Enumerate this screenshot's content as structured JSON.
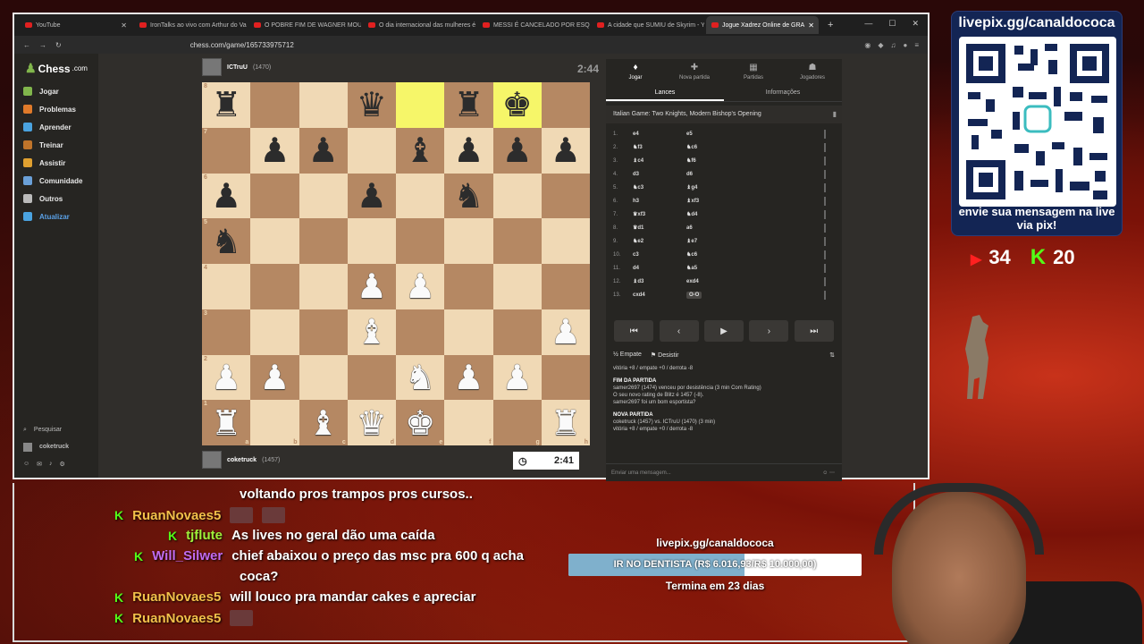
{
  "browser": {
    "tabs": [
      {
        "label": "YouTube",
        "active": false
      },
      {
        "label": "IronTalks ao vivo com Arthur do Val",
        "active": false
      },
      {
        "label": "O POBRE FIM DE WAGNER MOURA",
        "active": false
      },
      {
        "label": "O dia internacional das mulheres é u",
        "active": false
      },
      {
        "label": "MESSI É CANCELADO POR ESQUERD",
        "active": false
      },
      {
        "label": "A cidade que SUMIU de Skyrim - You",
        "active": false
      },
      {
        "label": "Jogue Xadrez Online de GRA",
        "active": true
      }
    ],
    "url": "chess.com/game/165733975712"
  },
  "sidebar": {
    "logo": "Chess",
    "logo_suffix": ".com",
    "items": [
      {
        "label": "Jogar",
        "color": "#81b64c"
      },
      {
        "label": "Problemas",
        "color": "#e07a2a"
      },
      {
        "label": "Aprender",
        "color": "#4aa3e0"
      },
      {
        "label": "Treinar",
        "color": "#c0742a"
      },
      {
        "label": "Assistir",
        "color": "#e0a030"
      },
      {
        "label": "Comunidade",
        "color": "#6aa0d8"
      },
      {
        "label": "Outros",
        "color": "#bbbbbb"
      },
      {
        "label": "Atualizar",
        "color": "#4aa3e0"
      }
    ],
    "search": "Pesquisar",
    "user": "coketruck"
  },
  "game": {
    "top_player": {
      "name": "ICTruU",
      "rating": "(1470)",
      "clock": "2:44"
    },
    "bottom_player": {
      "name": "coketruck",
      "rating": "(1457)",
      "clock": "2:41"
    },
    "board": [
      [
        "br",
        "",
        "",
        "bq",
        "",
        "br",
        "bk",
        ""
      ],
      [
        "",
        "bp",
        "bp",
        "",
        "bb",
        "bp",
        "bp",
        "bp"
      ],
      [
        "bp",
        "",
        "",
        "bp",
        "",
        "bn",
        "",
        ""
      ],
      [
        "bn",
        "",
        "",
        "",
        "",
        "",
        "",
        ""
      ],
      [
        "",
        "",
        "",
        "wp",
        "wp",
        "",
        "",
        ""
      ],
      [
        "",
        "",
        "",
        "wb",
        "",
        "",
        "",
        "wp"
      ],
      [
        "wp",
        "wp",
        "",
        "",
        "wn",
        "wp",
        "wp",
        ""
      ],
      [
        "wr",
        "",
        "wb",
        "wq",
        "wk",
        "",
        "",
        "wr"
      ]
    ],
    "highlight": [
      "e8",
      "g8"
    ],
    "ranks": [
      "8",
      "7",
      "6",
      "5",
      "4",
      "3",
      "2",
      "1"
    ],
    "files": [
      "a",
      "b",
      "c",
      "d",
      "e",
      "f",
      "g",
      "h"
    ]
  },
  "panel": {
    "tabs": [
      {
        "label": "Jogar",
        "icon": "♦"
      },
      {
        "label": "Nova partida",
        "icon": "✚"
      },
      {
        "label": "Partidas",
        "icon": "▦"
      },
      {
        "label": "Jogadores",
        "icon": "☗"
      }
    ],
    "subtabs": [
      "Lances",
      "Informações"
    ],
    "opening": "Italian Game: Two Knights, Modern Bishop's Opening",
    "moves": [
      {
        "n": "1.",
        "w": "e4",
        "b": "e5"
      },
      {
        "n": "2.",
        "w": "♞f3",
        "b": "♞c6"
      },
      {
        "n": "3.",
        "w": "♝c4",
        "b": "♞f6"
      },
      {
        "n": "4.",
        "w": "d3",
        "b": "d6"
      },
      {
        "n": "5.",
        "w": "♞c3",
        "b": "♝g4"
      },
      {
        "n": "6.",
        "w": "h3",
        "b": "♝xf3"
      },
      {
        "n": "7.",
        "w": "♛xf3",
        "b": "♞d4"
      },
      {
        "n": "8.",
        "w": "♛d1",
        "b": "a6"
      },
      {
        "n": "9.",
        "w": "♞e2",
        "b": "♝e7"
      },
      {
        "n": "10.",
        "w": "c3",
        "b": "♞c6"
      },
      {
        "n": "11.",
        "w": "d4",
        "b": "♞a5"
      },
      {
        "n": "12.",
        "w": "♝d3",
        "b": "exd4"
      },
      {
        "n": "13.",
        "w": "cxd4",
        "b": "O-O"
      }
    ],
    "controls": [
      "⏮",
      "‹",
      "▶",
      "›",
      "⏭"
    ],
    "actions": {
      "draw": "Empate",
      "resign": "Desistir"
    },
    "log": [
      {
        "bold": false,
        "text": "vitória +8 / empate +0 / derrota -8"
      },
      {
        "bold": true,
        "text": "FIM DA PARTIDA"
      },
      {
        "bold": false,
        "text": "samer2697 (1474) venceu por desistência (3 min Com Rating)"
      },
      {
        "bold": false,
        "text": "O seu novo rating de Blitz é 1457 (-8)."
      },
      {
        "bold": false,
        "text": "samer2697 foi um bom esportista?"
      },
      {
        "bold": true,
        "text": "NOVA PARTIDA"
      },
      {
        "bold": false,
        "text": "coketruck (1457) vs. ICTruU (1470) (3 min)"
      },
      {
        "bold": false,
        "text": "vitória +8 / empate +0 / derrota -8"
      }
    ],
    "message_placeholder": "Enviar uma mensagem..."
  },
  "overlay": {
    "qr_header": "livepix.gg/canaldococa",
    "qr_footer": "envie sua mensagem na live via pix!",
    "youtube_count": "34",
    "kick_count": "20",
    "chat": [
      {
        "user": "",
        "text": "voltando pros trampos pros cursos..",
        "user_color": "#ffffff"
      },
      {
        "user": "RuanNovaes5",
        "text": "",
        "user_color": "#f2c04a"
      },
      {
        "user": "tjflute",
        "text": "As lives no geral dão uma caída",
        "user_color": "#9ef03a"
      },
      {
        "user": "Will_Silwer",
        "text": "chief abaixou o preço das msc pra 600 q acha",
        "user_color": "#c06bf0"
      },
      {
        "user": "",
        "text": "coca?",
        "user_color": "#ffffff"
      },
      {
        "user": "RuanNovaes5",
        "text": "will louco pra mandar cakes e apreciar",
        "user_color": "#f2c04a"
      },
      {
        "user": "RuanNovaes5",
        "text": "",
        "user_color": "#f2c04a"
      }
    ],
    "goal": {
      "title": "livepix.gg/canaldococa",
      "label": "IR NO DENTISTA (R$ 6.016,93/R$ 10.000,00)",
      "progress": 0.6017,
      "ends": "Termina em 23 dias"
    }
  }
}
